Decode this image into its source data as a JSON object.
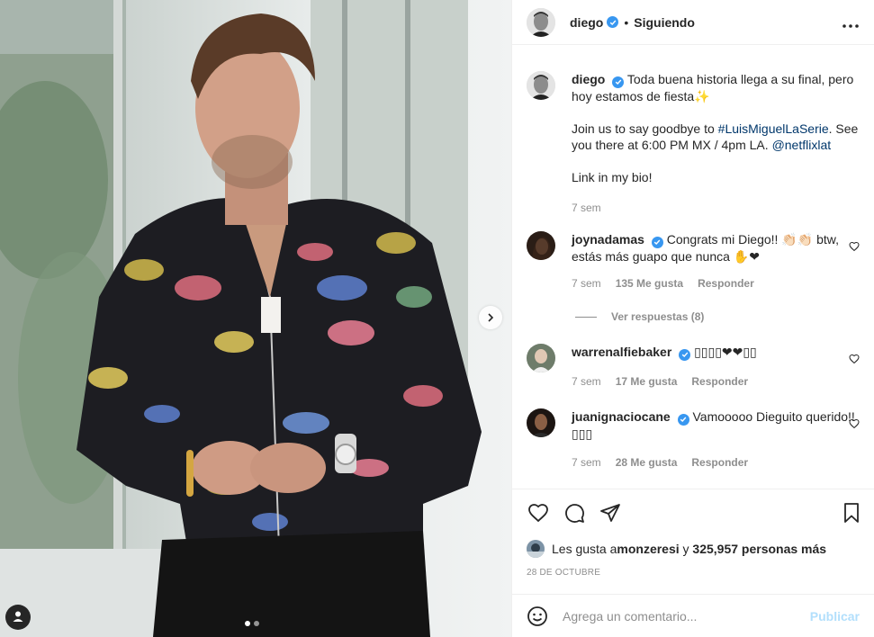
{
  "post": {
    "author": "diego",
    "follow_status": "Siguiendo",
    "bullet": "•",
    "photo": {
      "slide_count": 2,
      "active_slide": 1
    }
  },
  "caption": {
    "username": "diego",
    "text_line1": "Toda buena historia llega a su final, pero hoy estamos de fiesta",
    "sparkle": "✨",
    "text_p2_a": "Join us to say goodbye to ",
    "hashtag": "#LuisMiguelLaSerie",
    "text_p2_b": ". See you there at 6:00 PM MX / 4pm LA. ",
    "mention": "@netflixlat",
    "text_p3": "Link in my bio!",
    "time": "7 sem"
  },
  "comments": [
    {
      "username": "joynadamas",
      "text": "Congrats mi Diego!! 👏🏻👏🏻 btw, estás más guapo que nunca ✋❤",
      "time": "7 sem",
      "likes": "135 Me gusta",
      "reply": "Responder",
      "view_replies": "Ver respuestas (8)"
    },
    {
      "username": "warrenalfiebaker",
      "text": "▯▯▯▯❤❤▯▯",
      "time": "7 sem",
      "likes": "17 Me gusta",
      "reply": "Responder"
    },
    {
      "username": "juanignaciocane",
      "text": "Vamooooo Dieguito querido!!▯▯▯",
      "time": "7 sem",
      "likes": "28 Me gusta",
      "reply": "Responder"
    }
  ],
  "likes": {
    "prefix": "Les gusta a ",
    "user": "monzeresi",
    "middle": " y ",
    "count": "325,957 personas más"
  },
  "date": "28 DE OCTUBRE",
  "composer": {
    "placeholder": "Agrega un comentario...",
    "post_label": "Publicar"
  },
  "colors": {
    "verified": "#3897f0",
    "link": "#00376b",
    "secondary_text": "#8e8e8e",
    "post_button_disabled": "#b2dffc"
  }
}
